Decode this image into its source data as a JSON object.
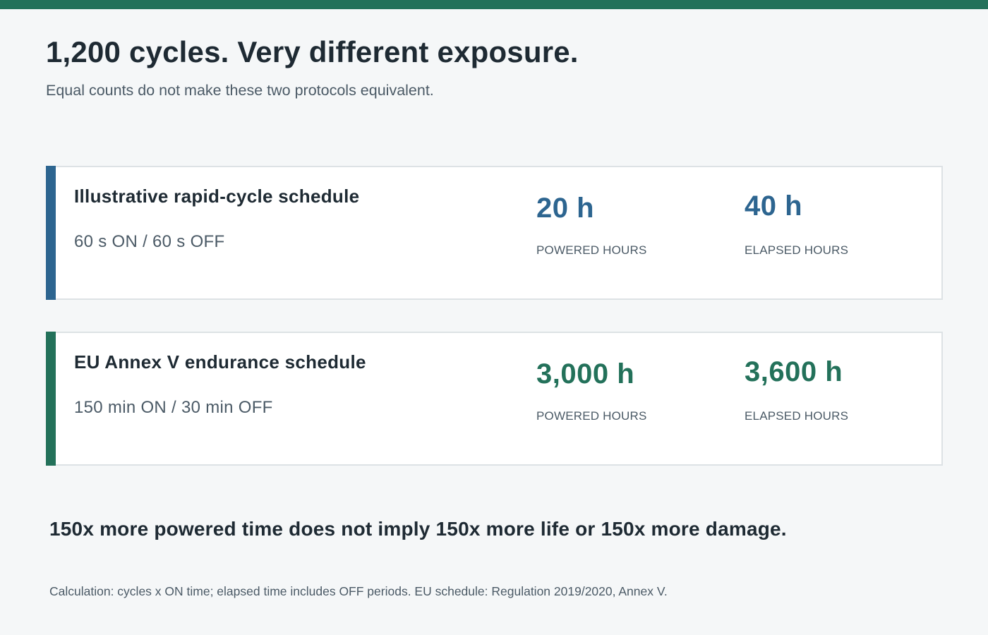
{
  "header": {
    "title": "1,200 cycles. Very different exposure.",
    "subtitle": "Equal counts do not make these two protocols equivalent."
  },
  "cards": [
    {
      "title": "Illustrative rapid-cycle schedule",
      "schedule": "60 s ON / 60 s OFF",
      "powered_value": "20 h",
      "powered_label": "POWERED HOURS",
      "elapsed_value": "40 h",
      "elapsed_label": "ELAPSED HOURS",
      "accent_color": "#2d6590"
    },
    {
      "title": "EU Annex V endurance schedule",
      "schedule": "150 min ON / 30 min OFF",
      "powered_value": "3,000 h",
      "powered_label": "POWERED HOURS",
      "elapsed_value": "3,600 h",
      "elapsed_label": "ELAPSED HOURS",
      "accent_color": "#23715a"
    }
  ],
  "conclusion": "150x more powered time does not imply 150x more life or 150x more damage.",
  "footnote": "Calculation: cycles x ON time; elapsed time includes OFF periods. EU schedule: Regulation 2019/2020, Annex V."
}
